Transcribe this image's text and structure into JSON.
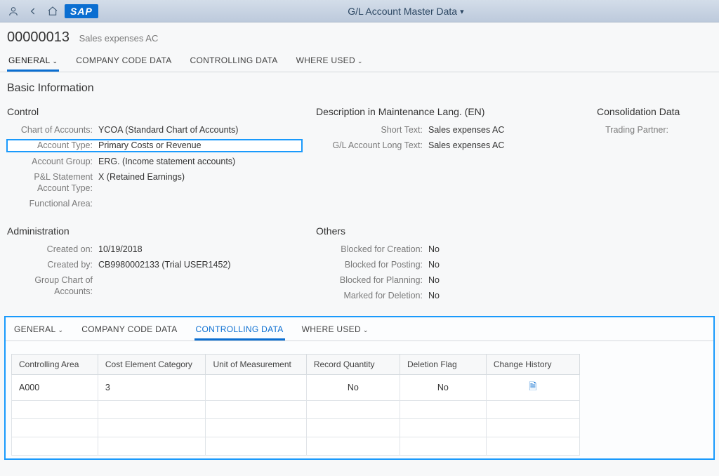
{
  "topbar": {
    "title": "G/L Account Master Data"
  },
  "object": {
    "number": "00000013",
    "desc": "Sales expenses AC"
  },
  "tabs_upper": {
    "general": "GENERAL",
    "company": "COMPANY CODE DATA",
    "controlling": "CONTROLLING DATA",
    "where": "WHERE USED"
  },
  "section_basic": "Basic Information",
  "control": {
    "heading": "Control",
    "chart_of_accounts_label": "Chart of Accounts:",
    "chart_of_accounts": "YCOA (Standard Chart of Accounts)",
    "account_type_label": "Account Type:",
    "account_type": "Primary Costs or Revenue",
    "account_group_label": "Account Group:",
    "account_group": "ERG. (Income statement accounts)",
    "pl_label": "P&L Statement Account Type:",
    "pl": "X (Retained Earnings)",
    "func_label": "Functional Area:",
    "func": ""
  },
  "descblock": {
    "heading": "Description in Maintenance Lang. (EN)",
    "short_label": "Short Text:",
    "short": "Sales expenses AC",
    "long_label": "G/L Account Long Text:",
    "long": "Sales expenses AC"
  },
  "consol": {
    "heading": "Consolidation Data",
    "trading_label": "Trading Partner:",
    "trading": ""
  },
  "admin": {
    "heading": "Administration",
    "created_on_label": "Created on:",
    "created_on": "10/19/2018",
    "created_by_label": "Created by:",
    "created_by": "CB9980002133 (Trial USER1452)",
    "group_label": "Group Chart of Accounts:",
    "group": ""
  },
  "others": {
    "heading": "Others",
    "bcreate_label": "Blocked for Creation:",
    "bcreate": "No",
    "bpost_label": "Blocked for Posting:",
    "bpost": "No",
    "bplan_label": "Blocked for Planning:",
    "bplan": "No",
    "mdel_label": "Marked for Deletion:",
    "mdel": "No"
  },
  "lower_tabs": {
    "general": "GENERAL",
    "company": "COMPANY CODE DATA",
    "controlling": "CONTROLLING DATA",
    "where": "WHERE USED"
  },
  "table": {
    "cols": {
      "c0": "Controlling Area",
      "c1": "Cost Element Category",
      "c2": "Unit of Measurement",
      "c3": "Record Quantity",
      "c4": "Deletion Flag",
      "c5": "Change History"
    },
    "rows": [
      {
        "area": "A000",
        "cat": "3",
        "uom": "",
        "recq": "No",
        "delf": "No",
        "hist_icon": true
      }
    ]
  }
}
